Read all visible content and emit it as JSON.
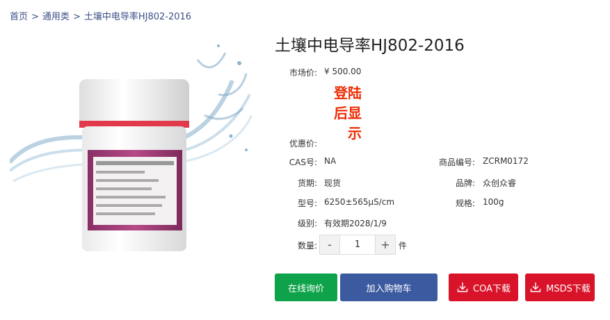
{
  "breadcrumb": {
    "home": "首页",
    "separator": ">",
    "category": "通用类",
    "current": "土壤中电导率HJ802-2016"
  },
  "product": {
    "title": "土壤中电导率HJ802-2016",
    "market_price_label": "市场价:",
    "market_price": "¥ 500.00",
    "discount_label": "优惠价:",
    "login_note": "登陆后显示",
    "cas_label": "CAS号:",
    "cas": "NA",
    "sku_label": "商品编号:",
    "sku": "ZCRM0172",
    "stock_label": "货期:",
    "stock": "现货",
    "brand_label": "品牌:",
    "brand": "众创众睿",
    "model_label": "型号:",
    "model": "6250±565μS/cm",
    "spec_label": "规格:",
    "spec": "100g",
    "grade_label": "级别:",
    "grade": "有效期2028/1/9"
  },
  "quantity": {
    "label": "数量:",
    "minus": "-",
    "value": "1",
    "plus": "+",
    "unit": "件"
  },
  "actions": {
    "inquiry": "在线询价",
    "add_to_cart": "加入购物车",
    "coa_download": "COA下载",
    "msds_download": "MSDS下载"
  },
  "colors": {
    "green": "#0ea34a",
    "blue": "#3c5aa0",
    "red": "#d9142a",
    "login_note": "#ee2a00",
    "breadcrumb": "#3a4f87"
  },
  "icons": {
    "download": "download-icon"
  }
}
